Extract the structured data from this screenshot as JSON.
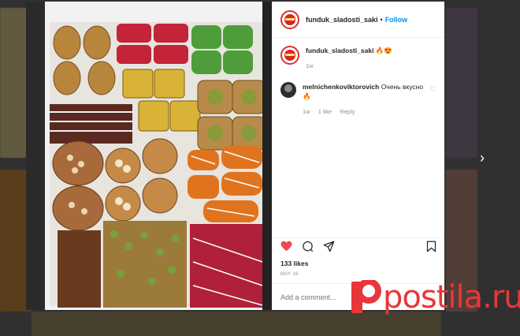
{
  "post": {
    "username": "funduk_sladosti_saki",
    "separator": "•",
    "follow_label": "Follow",
    "caption_username": "funduk_sladosti_saki",
    "caption_text": "🔥😍",
    "caption_age": "1w",
    "comment": {
      "username": "melnichenkoviktorovich",
      "text": "Очень вкусно 🔥",
      "age": "1w",
      "likes": "1 like",
      "reply_label": "Reply"
    },
    "likes_count": "133 likes",
    "date": "MAY 16",
    "add_comment_placeholder": "Add a comment...",
    "icons": [
      "heart-icon",
      "comment-icon",
      "share-icon",
      "bookmark-icon"
    ],
    "liked": true
  },
  "watermark": {
    "text": "postila.ru"
  },
  "colors": {
    "accent": "#0095f6",
    "like": "#ed4956",
    "brand": "#e8363a"
  }
}
